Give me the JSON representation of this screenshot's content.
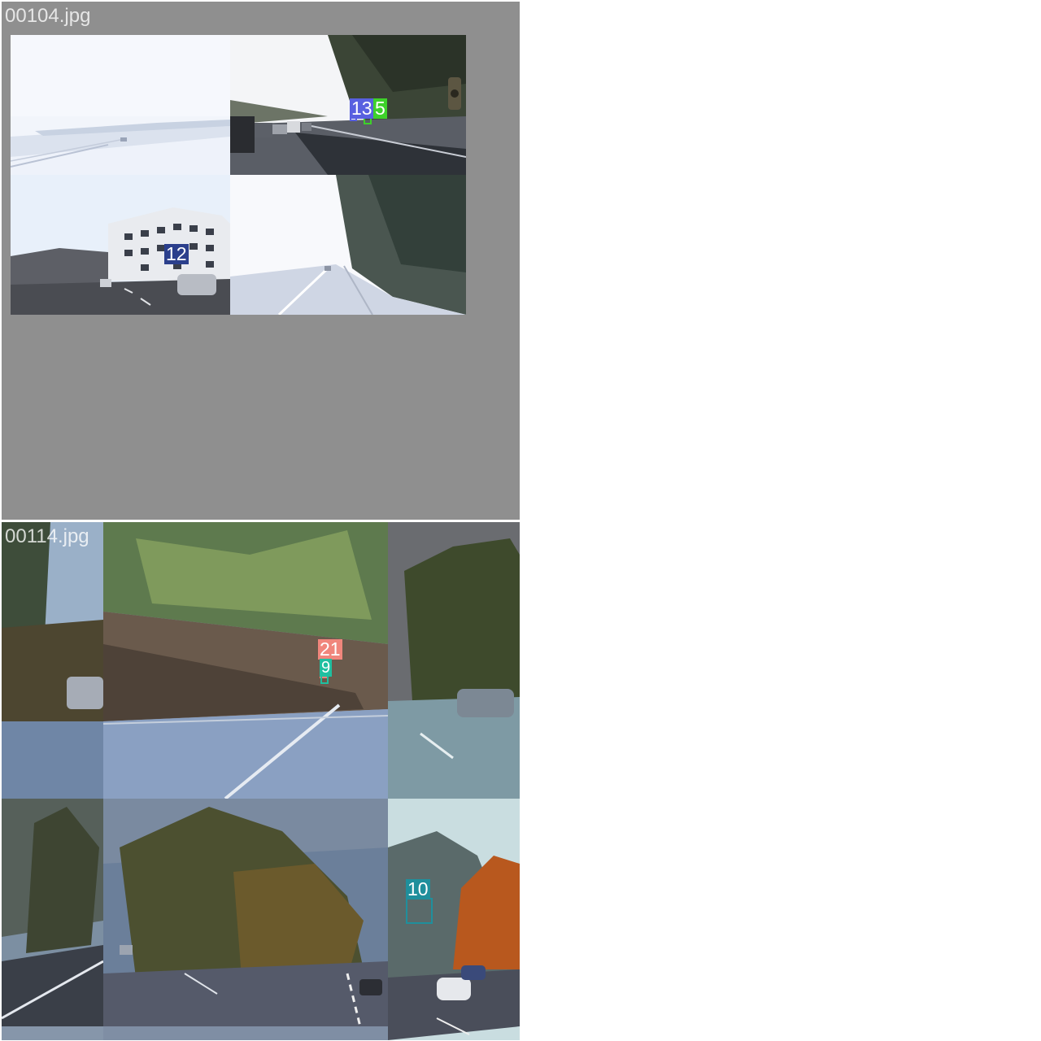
{
  "mosaics": [
    {
      "filename": "00104.jpg",
      "labels": [
        {
          "text": "13",
          "color": "#5860e0"
        },
        {
          "text": "5",
          "color": "#3ed12a"
        },
        {
          "text": "12",
          "color": "#2b3f8c"
        }
      ]
    },
    {
      "filename": "00114.jpg",
      "labels": [
        {
          "text": "21",
          "color": "#f0867c"
        },
        {
          "text": "9",
          "color": "#1fbfa0"
        },
        {
          "text": "10",
          "color": "#1f8f9c"
        }
      ]
    }
  ]
}
